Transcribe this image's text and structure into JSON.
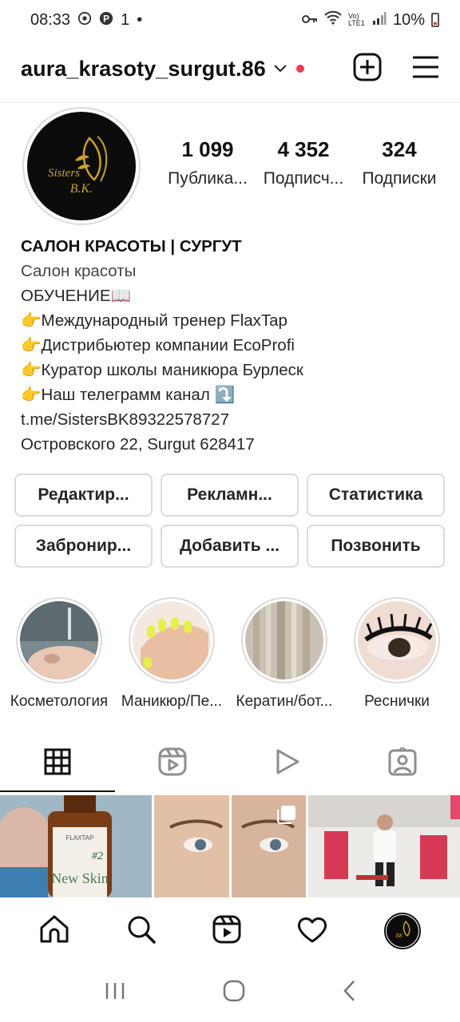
{
  "status_bar": {
    "time": "08:33",
    "notif_extra": "1",
    "battery": "10%",
    "lte_label": "Vo) LTE1"
  },
  "header": {
    "username": "aura_krasoty_surgut.86",
    "new_post_icon": "plus-square-icon",
    "menu_icon": "hamburger-menu-icon"
  },
  "profile": {
    "avatar_text_top": "Sisters",
    "avatar_text_bottom": "B.K.",
    "stats": [
      {
        "value": "1 099",
        "label": "Публика..."
      },
      {
        "value": "4 352",
        "label": "Подписч..."
      },
      {
        "value": "324",
        "label": "Подписки"
      }
    ]
  },
  "bio": {
    "name": "САЛОН КРАСОТЫ | СУРГУТ",
    "category": "Салон красоты",
    "lines": [
      "ОБУЧЕНИЕ📖",
      "👉Международный тренер FlaxTap",
      "👉Дистрибьютер компании EcoProfi",
      "👉Куратор школы маникюра Бурлеск",
      "👉Наш телеграмм канал ⤵️",
      "t.me/SistersBK89322578727",
      "Островского 22, Surgut 628417"
    ]
  },
  "buttons": {
    "row1": [
      "Редактир...",
      "Рекламн...",
      "Статистика"
    ],
    "row2": [
      "Забронир...",
      "Добавить ...",
      "Позвонить"
    ]
  },
  "highlights": [
    {
      "label": "Косметология"
    },
    {
      "label": "Маникюр/Пе..."
    },
    {
      "label": "Кератин/бот..."
    },
    {
      "label": "Реснички"
    }
  ],
  "tabs": [
    {
      "icon": "grid-icon",
      "active": true
    },
    {
      "icon": "reels-icon",
      "active": false
    },
    {
      "icon": "play-icon",
      "active": false
    },
    {
      "icon": "tagged-icon",
      "active": false
    }
  ],
  "grid_posts": [
    {
      "caption": "FLAXTAP",
      "sub": "New Skin",
      "num": "#2"
    },
    {
      "multi": true
    },
    {
      "reel": true
    }
  ],
  "bottom_nav": [
    "home-icon",
    "search-icon",
    "reels-icon",
    "heart-icon",
    "profile-avatar"
  ],
  "system_nav": [
    "recents-icon",
    "home-circle-icon",
    "back-icon"
  ]
}
